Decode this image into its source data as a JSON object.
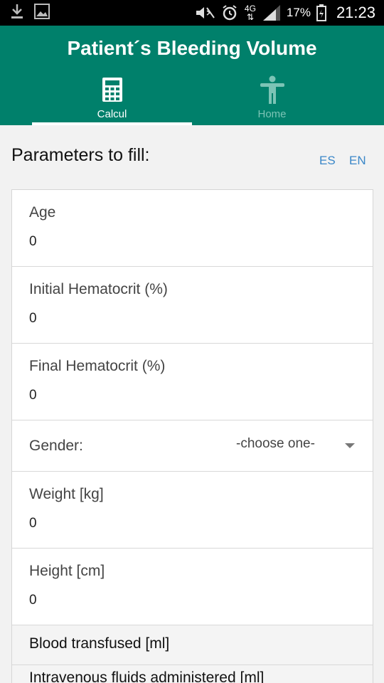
{
  "status_bar": {
    "battery": "17%",
    "time": "21:23",
    "network": "4G",
    "icons": [
      "download-icon",
      "image-icon",
      "mute-icon",
      "alarm-icon",
      "signal-icon",
      "battery-icon"
    ]
  },
  "header": {
    "title": "Patient´s Bleeding Volume",
    "tabs": [
      {
        "label": "Calcul",
        "icon": "calculator-icon",
        "active": true
      },
      {
        "label": "Home",
        "icon": "person-icon",
        "active": false
      }
    ],
    "color": "#00806b"
  },
  "section": {
    "title": "Parameters to fill:",
    "languages": [
      "ES",
      "EN"
    ]
  },
  "fields": {
    "age": {
      "label": "Age",
      "value": "0"
    },
    "initial_hematocrit": {
      "label": "Initial Hematocrit (%)",
      "value": "0"
    },
    "final_hematocrit": {
      "label": "Final Hematocrit (%)",
      "value": "0"
    },
    "gender": {
      "label": "Gender:",
      "selected": "-choose one-"
    },
    "weight": {
      "label": "Weight [kg]",
      "value": "0"
    },
    "height": {
      "label": "Height [cm]",
      "value": "0"
    }
  },
  "groups": {
    "blood_transfused": "Blood transfused [ml]",
    "iv_fluids": "Intravenous fluids administered [ml]"
  }
}
